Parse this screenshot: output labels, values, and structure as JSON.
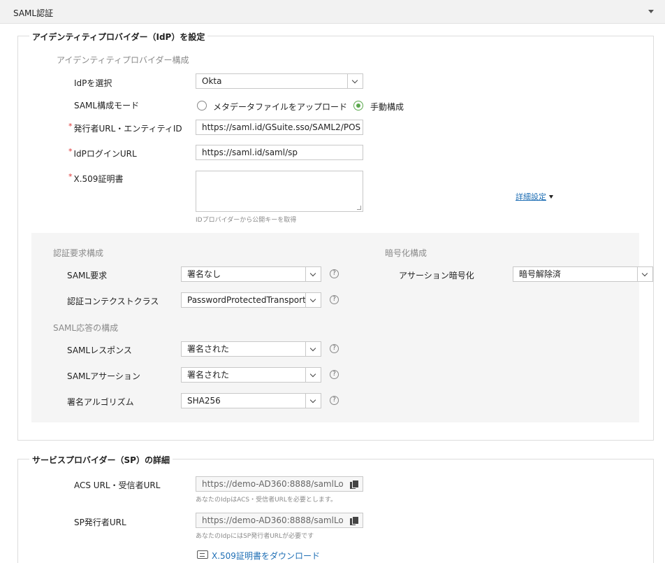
{
  "header": {
    "title": "SAML認証"
  },
  "idp": {
    "legend": "アイデンティティプロバイダー（IdP）を設定",
    "section": "アイデンティティプロバイダー構成",
    "select_idp": {
      "label": "IdPを選択",
      "value": "Okta"
    },
    "mode": {
      "label": "SAML構成モード",
      "option_upload": "メタデータファイルをアップロード",
      "option_manual": "手動構成",
      "selected": "manual"
    },
    "issuer": {
      "required": "*",
      "label": "発行者URL・エンティティID",
      "value": "https://saml.id/GSuite.sso/SAML2/POS"
    },
    "login_url": {
      "required": "*",
      "label": "IdPログインURL",
      "value": "https://saml.id/saml/sp"
    },
    "cert": {
      "required": "*",
      "label": "X.509証明書",
      "value": "",
      "hint": "IDプロバイダーから公開キーを取得"
    },
    "advanced_link": "詳細設定"
  },
  "auth_request": {
    "section": "認証要求構成",
    "saml_request": {
      "label": "SAML要求",
      "value": "署名なし"
    },
    "context_class": {
      "label": "認証コンテクストクラス",
      "value": "PasswordProtectedTransport"
    }
  },
  "saml_response": {
    "section": "SAML応答の構成",
    "response": {
      "label": "SAMLレスポンス",
      "value": "署名された"
    },
    "assertion": {
      "label": "SAMLアサーション",
      "value": "署名された"
    },
    "algorithm": {
      "label": "署名アルゴリズム",
      "value": "SHA256"
    }
  },
  "encryption": {
    "section": "暗号化構成",
    "assertion_encryption": {
      "label": "アサーション暗号化",
      "value": "暗号解除済"
    }
  },
  "sp": {
    "legend": "サービスプロバイダー（SP）の詳細",
    "acs": {
      "label": "ACS URL・受信者URL",
      "value": "https://demo-AD360:8888/samlLo",
      "hint": "あなたのIdpはACS・受信者URLを必要とします。"
    },
    "issuer": {
      "label": "SP発行者URL",
      "value": "https://demo-AD360:8888/samlLo",
      "hint": "あなたのIdpにはSP発行者URLが必要です"
    },
    "download": "X.509証明書をダウンロード"
  },
  "help_glyph": "?"
}
